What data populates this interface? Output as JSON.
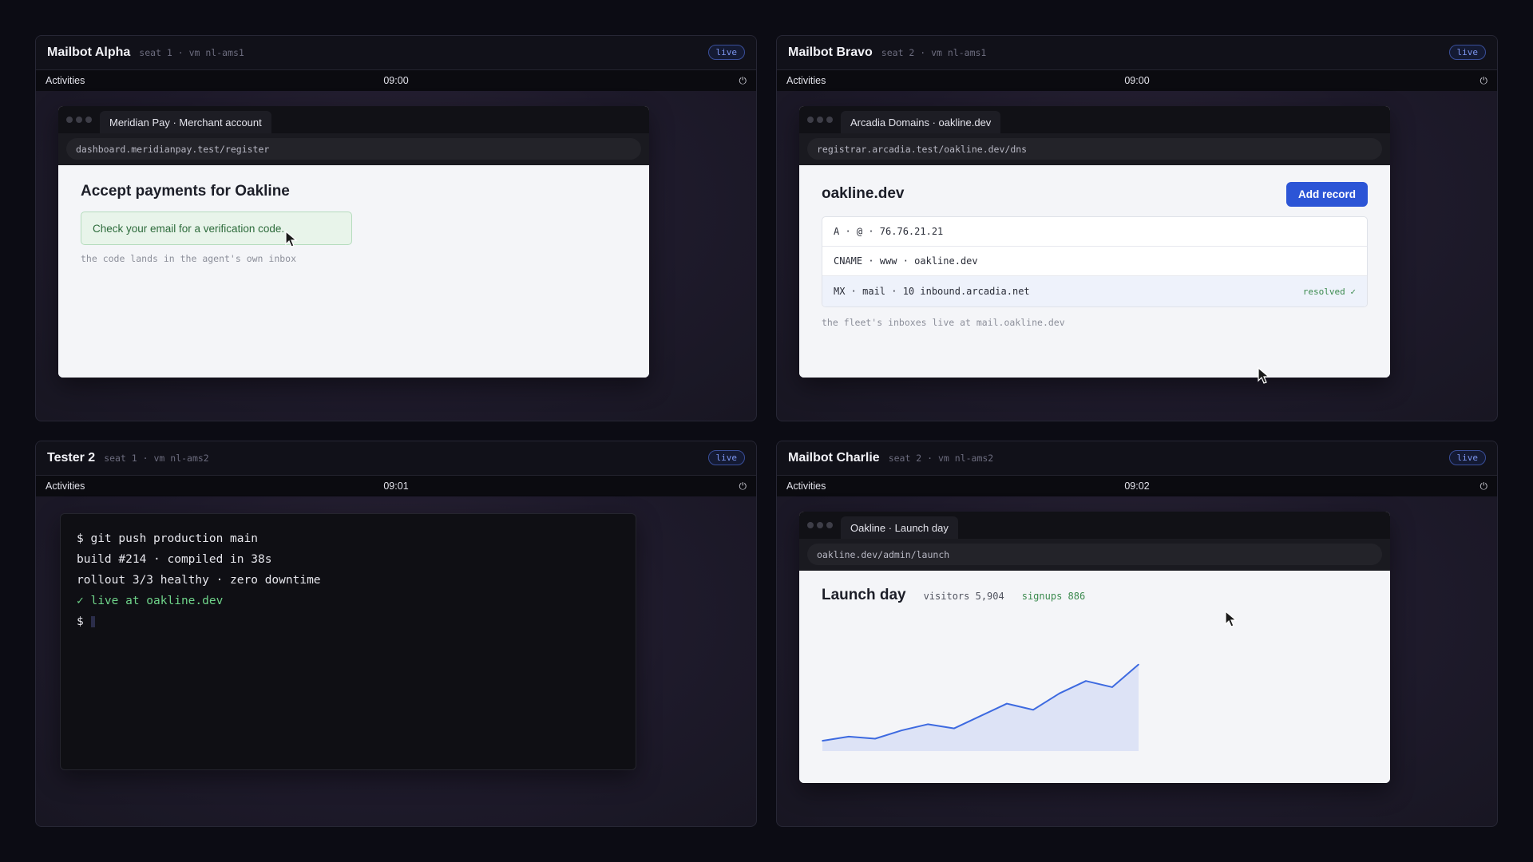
{
  "panels": [
    {
      "name": "Mailbot Alpha",
      "meta": "seat 1 · vm nl-ams1",
      "badge": "live",
      "topbar": {
        "activities": "Activities",
        "clock": "09:00"
      },
      "window": {
        "tab": "Meridian Pay · Merchant account",
        "url": "dashboard.meridianpay.test/register",
        "heading": "Accept payments for Oakline",
        "notice": "Check your email for a verification code.",
        "note": "the code lands in the agent's own inbox"
      }
    },
    {
      "name": "Mailbot Bravo",
      "meta": "seat 2 · vm nl-ams1",
      "badge": "live",
      "topbar": {
        "activities": "Activities",
        "clock": "09:00"
      },
      "window": {
        "tab": "Arcadia Domains · oakline.dev",
        "url": "registrar.arcadia.test/oakline.dev/dns",
        "heading": "oakline.dev",
        "button": "Add record",
        "records": [
          {
            "text": "A · @ · 76.76.21.21",
            "status": ""
          },
          {
            "text": "CNAME · www · oakline.dev",
            "status": ""
          },
          {
            "text": "MX · mail · 10 inbound.arcadia.net",
            "status": "resolved ✓"
          }
        ],
        "note": "the fleet's inboxes live at mail.oakline.dev"
      }
    },
    {
      "name": "Tester 2",
      "meta": "seat 1 · vm nl-ams2",
      "badge": "live",
      "topbar": {
        "activities": "Activities",
        "clock": "09:01"
      },
      "terminal": {
        "lines": [
          "$ git push production main",
          "build #214 · compiled in 38s",
          "rollout 3/3 healthy · zero downtime",
          "✓ live at oakline.dev"
        ],
        "prompt": "$"
      }
    },
    {
      "name": "Mailbot Charlie",
      "meta": "seat 2 · vm nl-ams2",
      "badge": "live",
      "topbar": {
        "activities": "Activities",
        "clock": "09:02"
      },
      "window": {
        "tab": "Oakline · Launch day",
        "url": "oakline.dev/admin/launch",
        "heading": "Launch day",
        "visitors": "visitors 5,904",
        "signups": "signups 886"
      }
    }
  ],
  "icons": {
    "power": "power-icon",
    "cursor": "mouse-cursor-icon"
  },
  "colors": {
    "live_badge": "#7d96f0",
    "success_green": "#3b8a4e",
    "primary_button": "#2c55d6",
    "chart_line": "#3d6ae0"
  },
  "chart_data": {
    "type": "area",
    "x": [
      1,
      2,
      3,
      4,
      5,
      6,
      7,
      8,
      9,
      10,
      11,
      12,
      13
    ],
    "values": [
      5,
      7,
      6,
      10,
      13,
      11,
      17,
      23,
      20,
      28,
      34,
      31,
      42
    ],
    "title": "",
    "xlabel": "",
    "ylabel": "",
    "ylim": [
      0,
      48
    ],
    "grid": false,
    "legend": "none"
  }
}
